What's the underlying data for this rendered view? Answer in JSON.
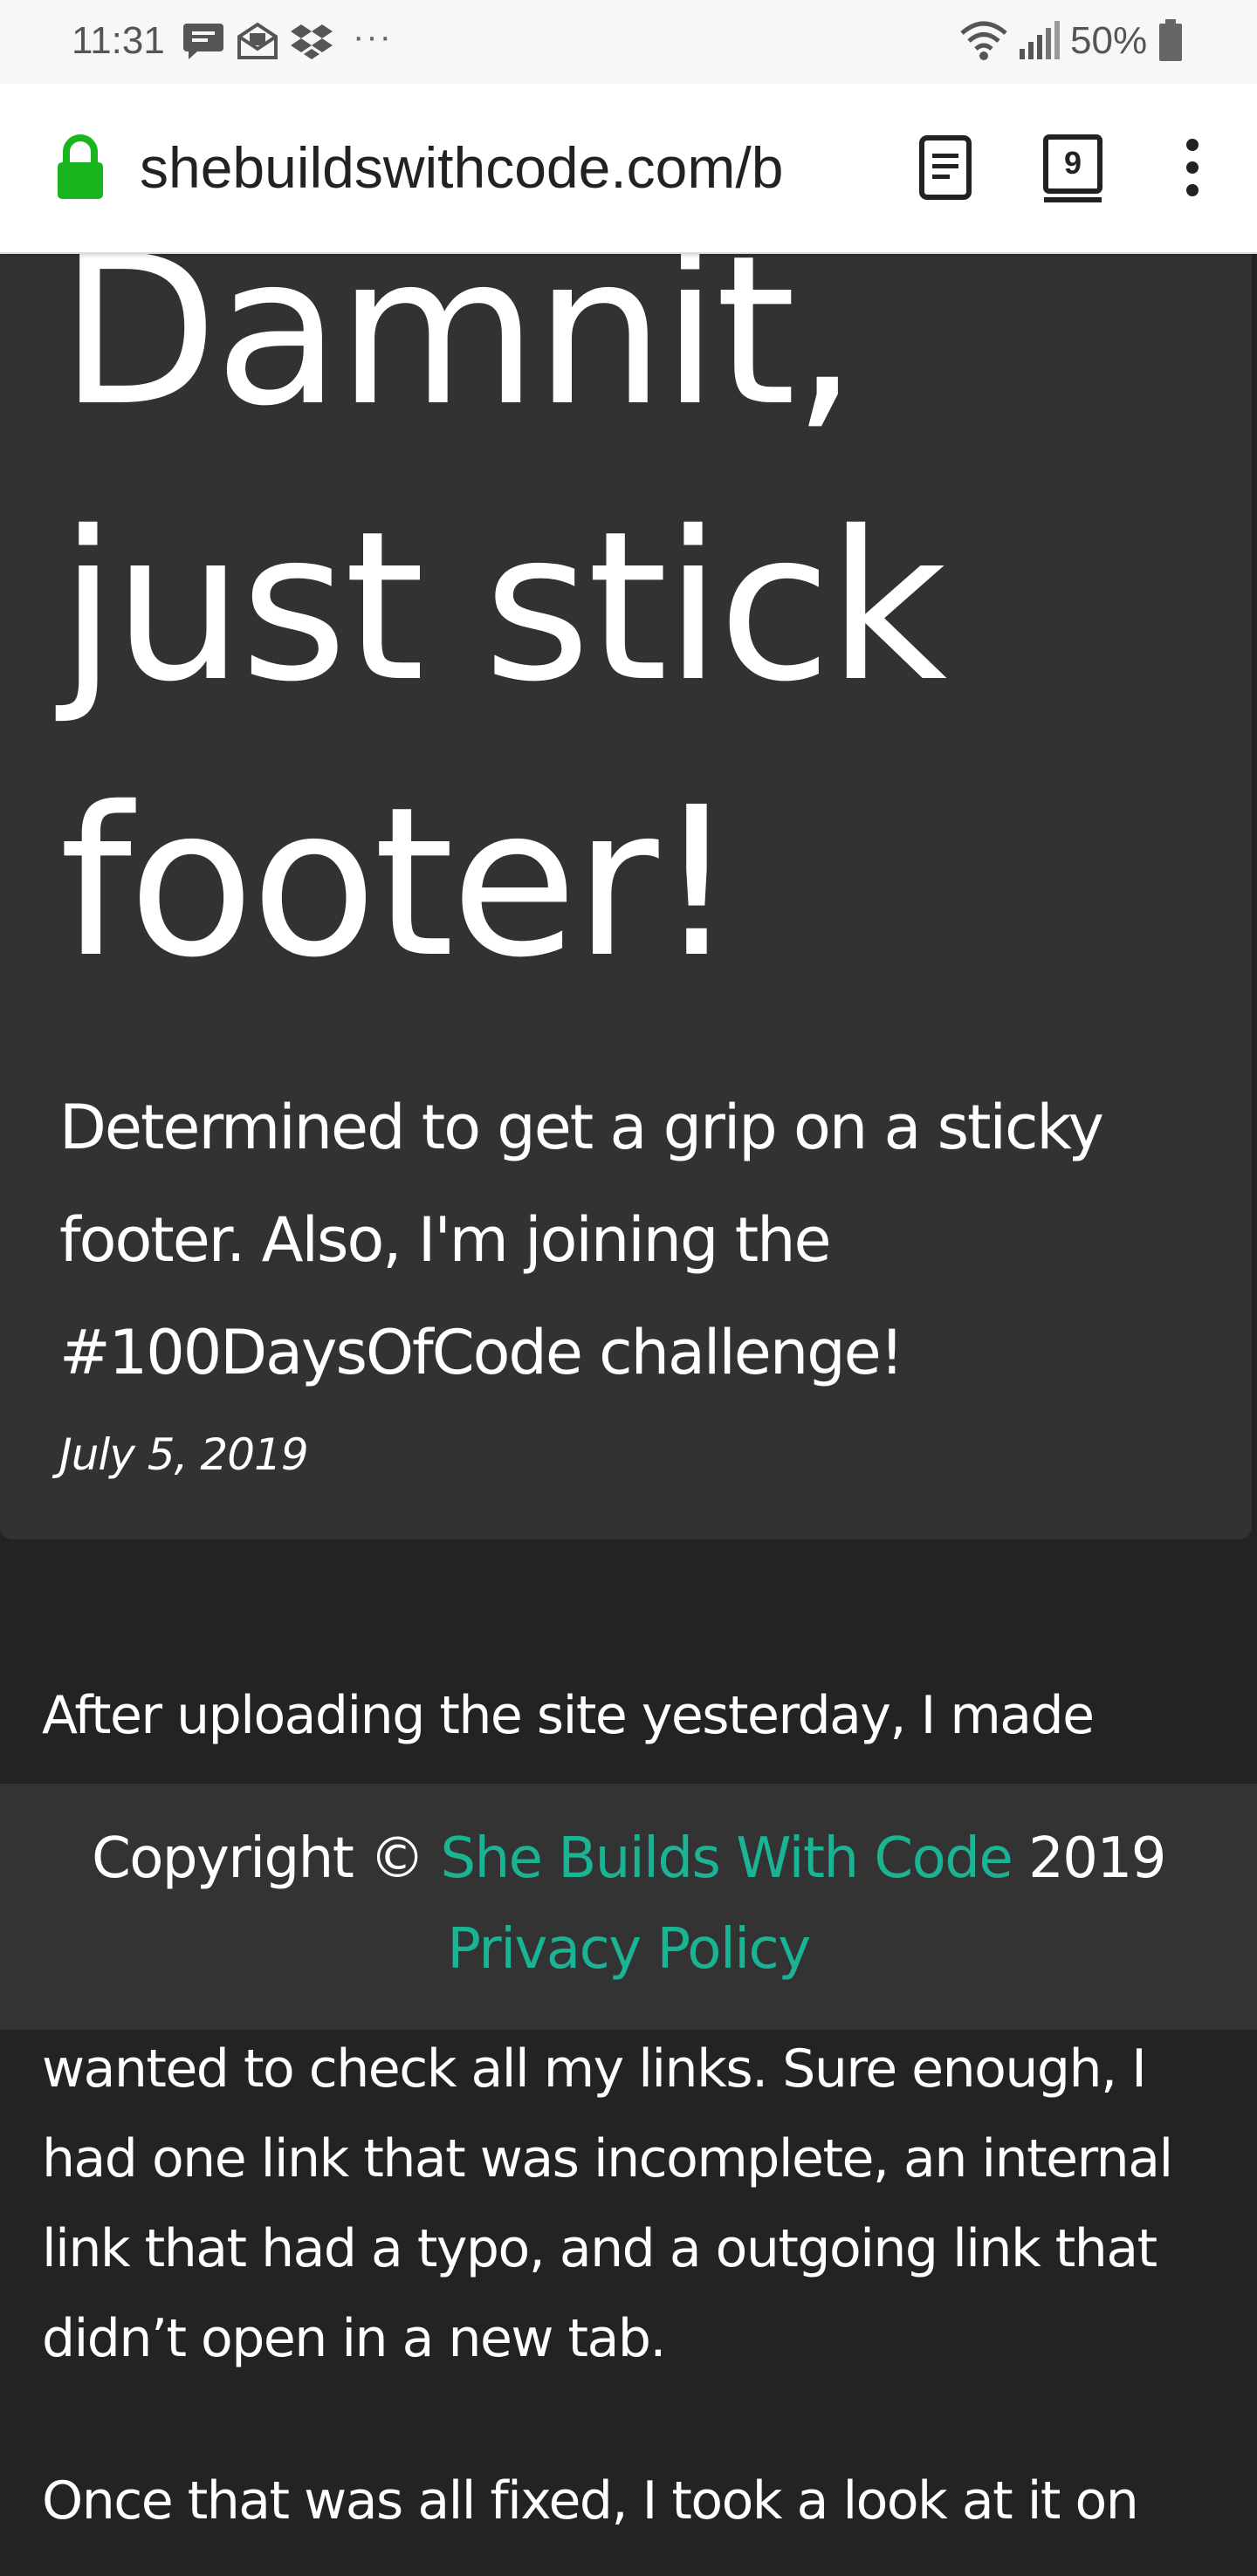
{
  "status_bar": {
    "time": "11:31",
    "more_indicator": "···",
    "battery_percent": "50%",
    "notification_icons": [
      "message-icon",
      "email-icon",
      "dropbox-icon"
    ],
    "system_icons": [
      "wifi-icon",
      "cellular-signal-icon",
      "battery-icon"
    ]
  },
  "browser": {
    "url": "shebuildswithcode.com/b",
    "tab_count": "9",
    "lock_color": "#19b51f"
  },
  "hero": {
    "title": "Damnit, just stick footer!",
    "subtitle": "Determined to get a grip on a sticky footer. Also, I'm joining the #100DaysOfCode challenge!",
    "date": "July 5, 2019"
  },
  "article": {
    "paragraph_1": "After uploading the site yesterday, I made",
    "paragraph_2": "wanted to check all my links. Sure enough, I had one link that was incomplete, an internal link that had a typo, and a outgoing link that didn’t open in a new tab.",
    "paragraph_3": "Once that was all fixed, I took a look at it on"
  },
  "footer": {
    "copyright_prefix": "Copyright ©",
    "site_link": "She Builds With Code",
    "year": "2019",
    "privacy_link": "Privacy Policy",
    "link_color": "#1ab394"
  }
}
